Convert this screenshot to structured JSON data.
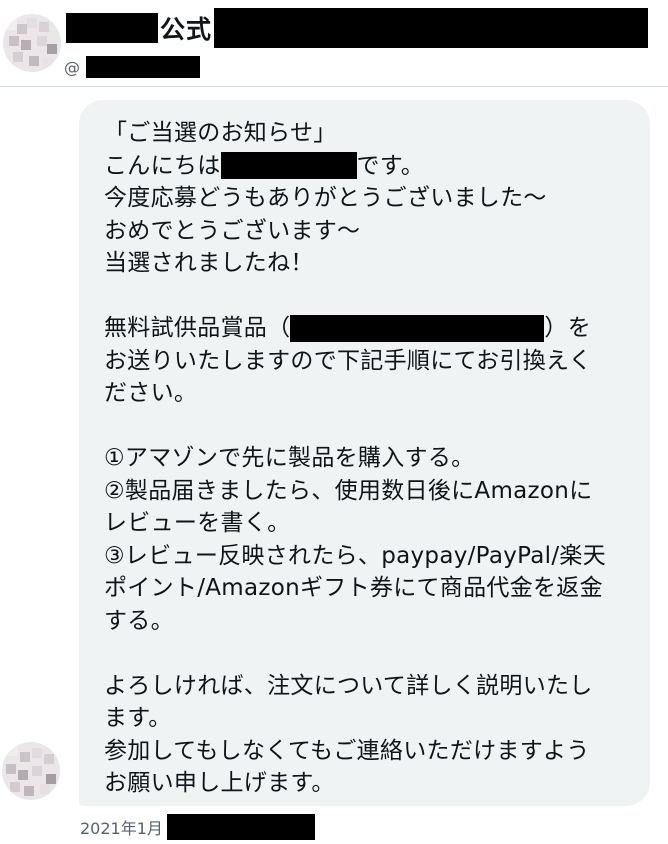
{
  "header": {
    "account_name": "公式",
    "handle_prefix": "@"
  },
  "message": {
    "lines": [
      "「ご当選のお知らせ」",
      "こんにちは",
      "です。",
      "今度応募どうもありがとうございました〜",
      "おめでとうございます〜",
      "当選されましたね！",
      "無料試供品賞品（",
      "）を",
      "お送りいたしますので下記手順にてお引換えく",
      "ださい。",
      "①アマゾンで先に製品を購入する。",
      "②製品届きましたら、使用数日後にAmazonに",
      "レビューを書く。",
      "③レビュー反映されたら、paypay/PayPal/楽天",
      "ポイント/Amazonギフト券にて商品代金を返金",
      "する。",
      "よろしければ、注文について詳しく説明いたし",
      "ます。",
      "参加してもしなくてもご連絡いただけますよう",
      "お願い申し上げます。"
    ]
  },
  "timestamp": "2021年1月"
}
